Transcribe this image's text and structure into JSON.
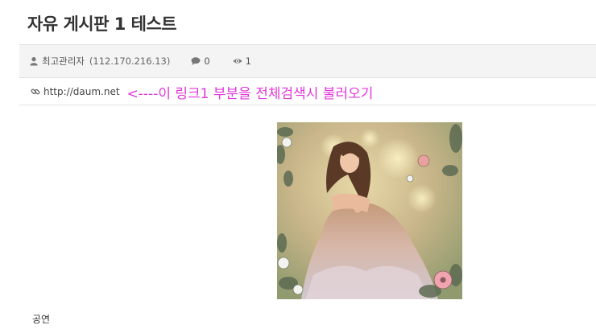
{
  "post": {
    "title": "자유 게시판 1 테스트",
    "author": "최고관리자",
    "ip": "(112.170.216.13)",
    "comment_count": "0",
    "view_count": "1",
    "link_url": "http://daum.net",
    "annotation": "<----이 링크1 부분을 전체검색시 불러오기",
    "body_text": "공연"
  },
  "icons": {
    "author": "user-icon",
    "comments": "comment-icon",
    "views": "eye-icon",
    "link": "link-icon"
  },
  "colors": {
    "annotation": "#e236d9",
    "meta_background": "#f4f4f4"
  }
}
